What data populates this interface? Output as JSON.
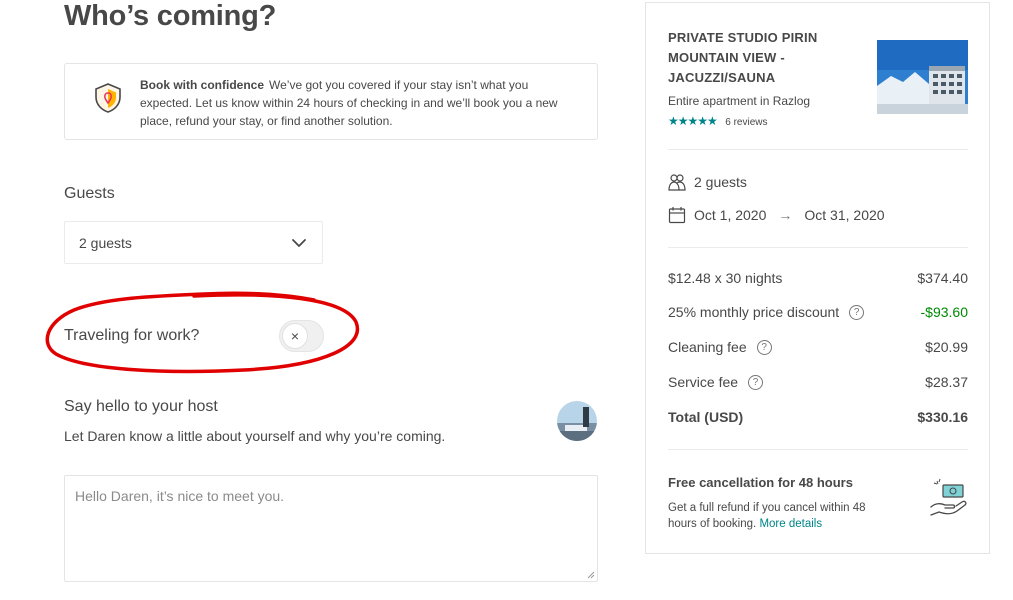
{
  "page": {
    "title": "Who’s coming?"
  },
  "confidence": {
    "title": "Book with confidence",
    "text": "We’ve got you covered if your stay isn’t what you expected. Let us know within 24 hours of checking in and we’ll book you a new place, refund your stay, or find another solution."
  },
  "guests": {
    "label": "Guests",
    "value": "2 guests"
  },
  "work": {
    "label": "Traveling for work?",
    "toggle_symbol": "×",
    "enabled": false
  },
  "host": {
    "title": "Say hello to your host",
    "subtitle": "Let Daren know a little about yourself and why you’re coming.",
    "message_placeholder": "Hello Daren, it’s nice to meet you."
  },
  "listing": {
    "title": "PRIVATE STUDIO PIRIN MOUNTAIN VIEW - JACUZZI/SAUNA",
    "type": "Entire apartment in Razlog",
    "stars": "★★★★★",
    "reviews": "6 reviews"
  },
  "trip": {
    "guests": "2 guests",
    "checkin": "Oct 1, 2020",
    "arrow": "→",
    "checkout": "Oct 31, 2020"
  },
  "pricing": {
    "nights_label": "$12.48 x 30 nights",
    "nights_value": "$374.40",
    "discount_label": "25% monthly price discount",
    "discount_value": "-$93.60",
    "cleaning_label": "Cleaning fee",
    "cleaning_value": "$20.99",
    "service_label": "Service fee",
    "service_value": "$28.37",
    "total_label": "Total (USD)",
    "total_value": "$330.16",
    "help_symbol": "?"
  },
  "cancellation": {
    "title": "Free cancellation for 48 hours",
    "text": "Get a full refund if you cancel within 48 hours of booking.",
    "more": "More details"
  },
  "colors": {
    "text": "#484848",
    "accent": "#008489",
    "discount": "#008a05",
    "annotation": "#e00000"
  }
}
